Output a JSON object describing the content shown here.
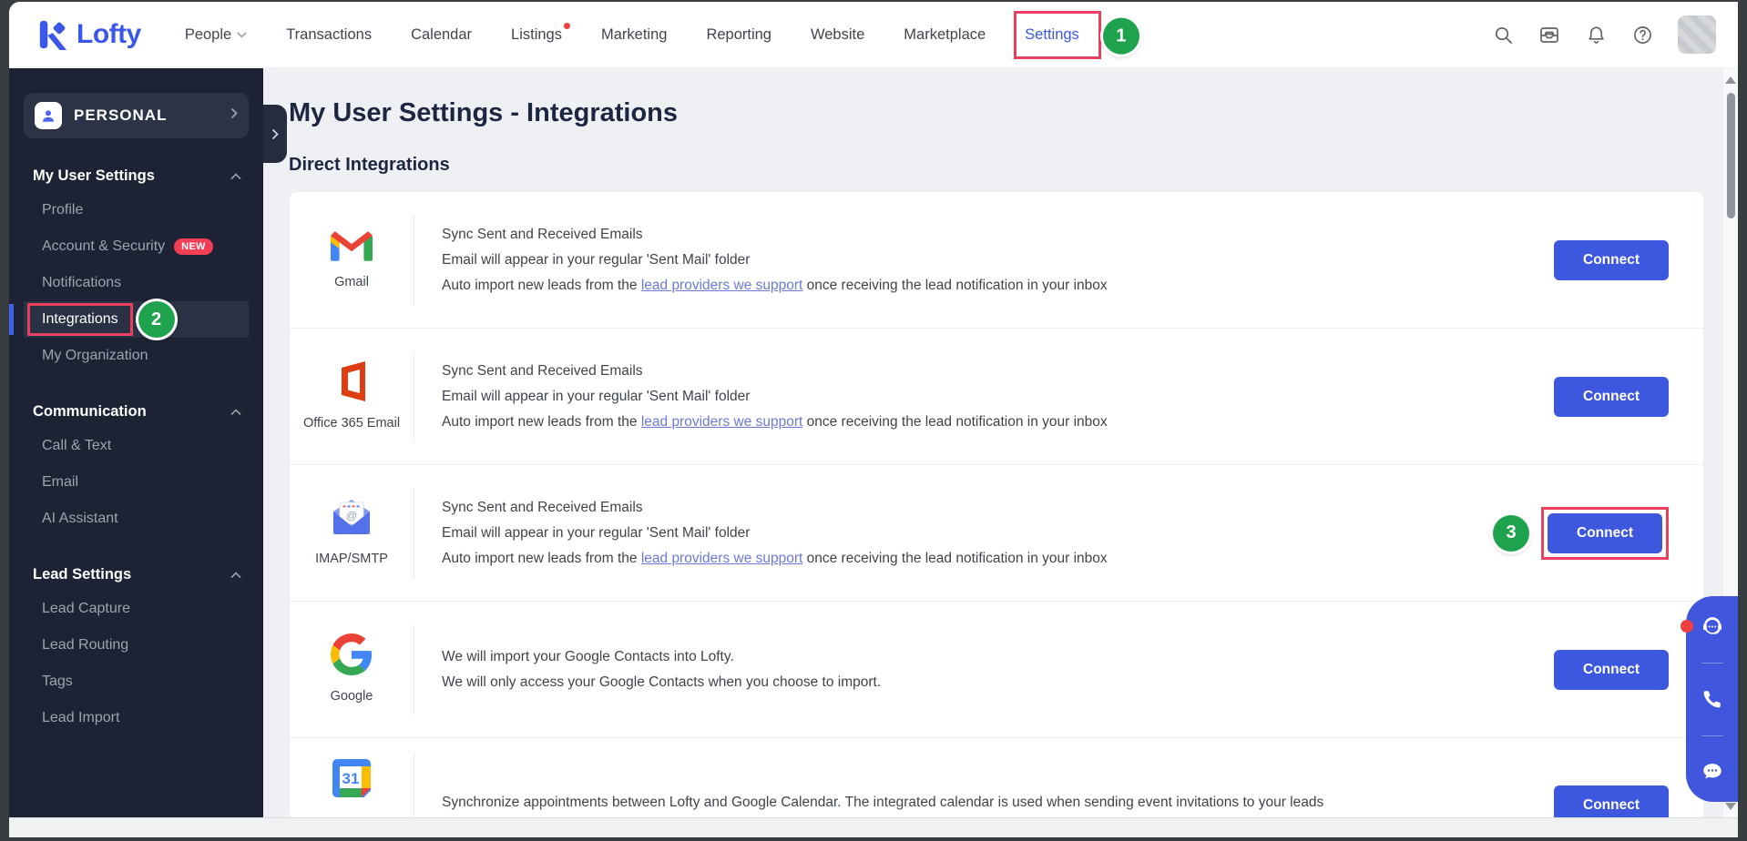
{
  "topnav": {
    "logo_text": "Lofty",
    "items": [
      {
        "label": "People",
        "has_dropdown": true
      },
      {
        "label": "Transactions"
      },
      {
        "label": "Calendar"
      },
      {
        "label": "Listings",
        "has_alert_dot": true
      },
      {
        "label": "Marketing"
      },
      {
        "label": "Reporting"
      },
      {
        "label": "Website"
      },
      {
        "label": "Marketplace"
      },
      {
        "label": "Settings",
        "active": true
      }
    ]
  },
  "annotations": {
    "step1": "1",
    "step2": "2",
    "step3": "3",
    "highlight_color": "#ea4060",
    "step_circle_color": "#1fa24e"
  },
  "sidebar": {
    "account_label": "PERSONAL",
    "sections": [
      {
        "title": "My User Settings",
        "items": [
          {
            "label": "Profile"
          },
          {
            "label": "Account & Security",
            "badge": "NEW"
          },
          {
            "label": "Notifications"
          },
          {
            "label": "Integrations",
            "active": true
          },
          {
            "label": "My Organization"
          }
        ]
      },
      {
        "title": "Communication",
        "items": [
          {
            "label": "Call & Text"
          },
          {
            "label": "Email"
          },
          {
            "label": "AI Assistant"
          }
        ]
      },
      {
        "title": "Lead Settings",
        "items": [
          {
            "label": "Lead Capture"
          },
          {
            "label": "Lead Routing"
          },
          {
            "label": "Tags"
          },
          {
            "label": "Lead Import"
          }
        ]
      }
    ]
  },
  "main": {
    "page_title": "My User Settings - Integrations",
    "section_title": "Direct Integrations",
    "integrations": [
      {
        "label": "Gmail",
        "icon": "gmail-icon",
        "line1": "Sync Sent and Received Emails",
        "line2": "Email will appear in your regular 'Sent Mail' folder",
        "line3_pre": "Auto import new leads from the ",
        "line3_link": "lead providers we support",
        "line3_post": " once receiving the lead notification in your inbox",
        "button": "Connect"
      },
      {
        "label": "Office 365 Email",
        "icon": "office365-icon",
        "line1": "Sync Sent and Received Emails",
        "line2": "Email will appear in your regular 'Sent Mail' folder",
        "line3_pre": "Auto import new leads from the ",
        "line3_link": "lead providers we support",
        "line3_post": " once receiving the lead notification in your inbox",
        "button": "Connect"
      },
      {
        "label": "IMAP/SMTP",
        "icon": "imap-smtp-icon",
        "line1": "Sync Sent and Received Emails",
        "line2": "Email will appear in your regular 'Sent Mail' folder",
        "line3_pre": "Auto import new leads from the ",
        "line3_link": "lead providers we support",
        "line3_post": " once receiving the lead notification in your inbox",
        "button": "Connect",
        "step": "3"
      },
      {
        "label": "Google",
        "icon": "google-icon",
        "line1": "We will import your Google Contacts into Lofty.",
        "line2": "We will only access your Google Contacts when you choose to import.",
        "button": "Connect"
      },
      {
        "label": "",
        "icon": "google-calendar-icon",
        "line1": "Synchronize appointments between Lofty and Google Calendar. The integrated calendar is used when sending event invitations to your leads",
        "button": "Connect"
      }
    ]
  },
  "colors": {
    "accent_blue": "#3a57e8",
    "button_blue": "#3e57df",
    "sidebar_bg": "#1d2334",
    "badge_red": "#f23e56"
  }
}
